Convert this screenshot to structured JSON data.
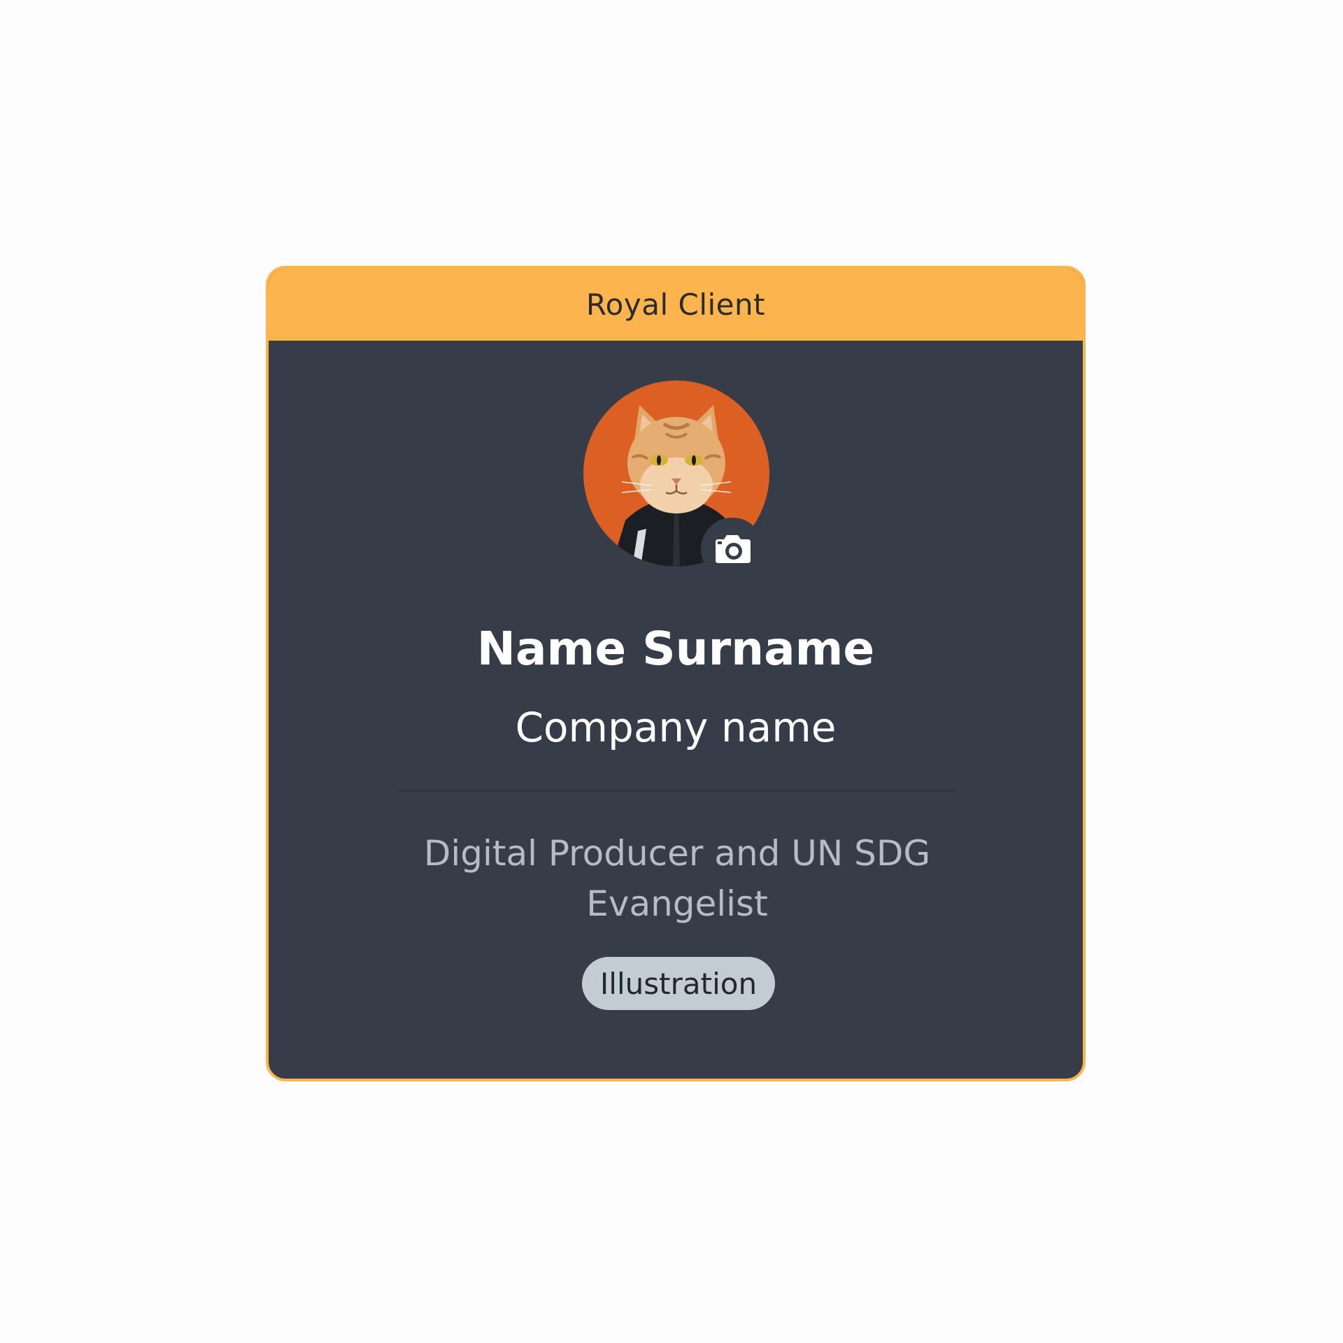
{
  "card": {
    "header_title": "Royal Client",
    "name": "Name Surname",
    "company": "Company name",
    "role": "Digital Producer and UN SDG Evangelist",
    "tag": "Illustration",
    "avatar_icon": "cat-portrait",
    "camera_icon": "camera-icon"
  },
  "colors": {
    "accent": "#fcb44f",
    "card_background": "#373d48",
    "tag_background": "#c3cbd3",
    "page_background": "#fdfdfd"
  }
}
